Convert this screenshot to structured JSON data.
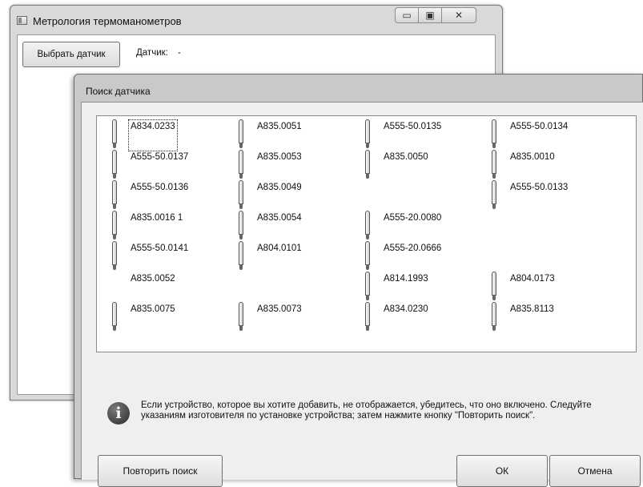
{
  "main_window": {
    "title": "Метрология термоманометров",
    "select_button": "Выбрать датчик",
    "sensor_label": "Датчик:",
    "sensor_value": "-",
    "caption": {
      "minimize": "▭",
      "maximize": "▣",
      "close": "✕"
    }
  },
  "dialog": {
    "title": "Поиск датчика",
    "sensors": [
      "А834.0233",
      "А835.0051",
      "А555-50.0135",
      "А555-50.0134",
      "А555-50.0137",
      "А835.0053",
      "А835.0050",
      "А835.0010",
      "А555-50.0136",
      "А835.0049",
      "А555-50.0133",
      "А835.0016 1",
      "А835.0054",
      "А555-20.0080",
      "А555-50.0141",
      "А804.0101",
      "А555-20.0666",
      "А835.0052",
      "А814.1993",
      "А804.0173",
      "А835.0075",
      "А835.0073",
      "А834.0230",
      "А835.8113"
    ],
    "info_icon": "i",
    "info_text": "Если устройство, которое вы хотите добавить, не отображается, убедитесь, что оно включено. Следуйте указаниям изготовителя по установке устройства; затем нажмите кнопку \"Повторить поиск\".",
    "buttons": {
      "retry": "Повторить поиск",
      "ok": "ОК",
      "cancel": "Отмена"
    }
  }
}
